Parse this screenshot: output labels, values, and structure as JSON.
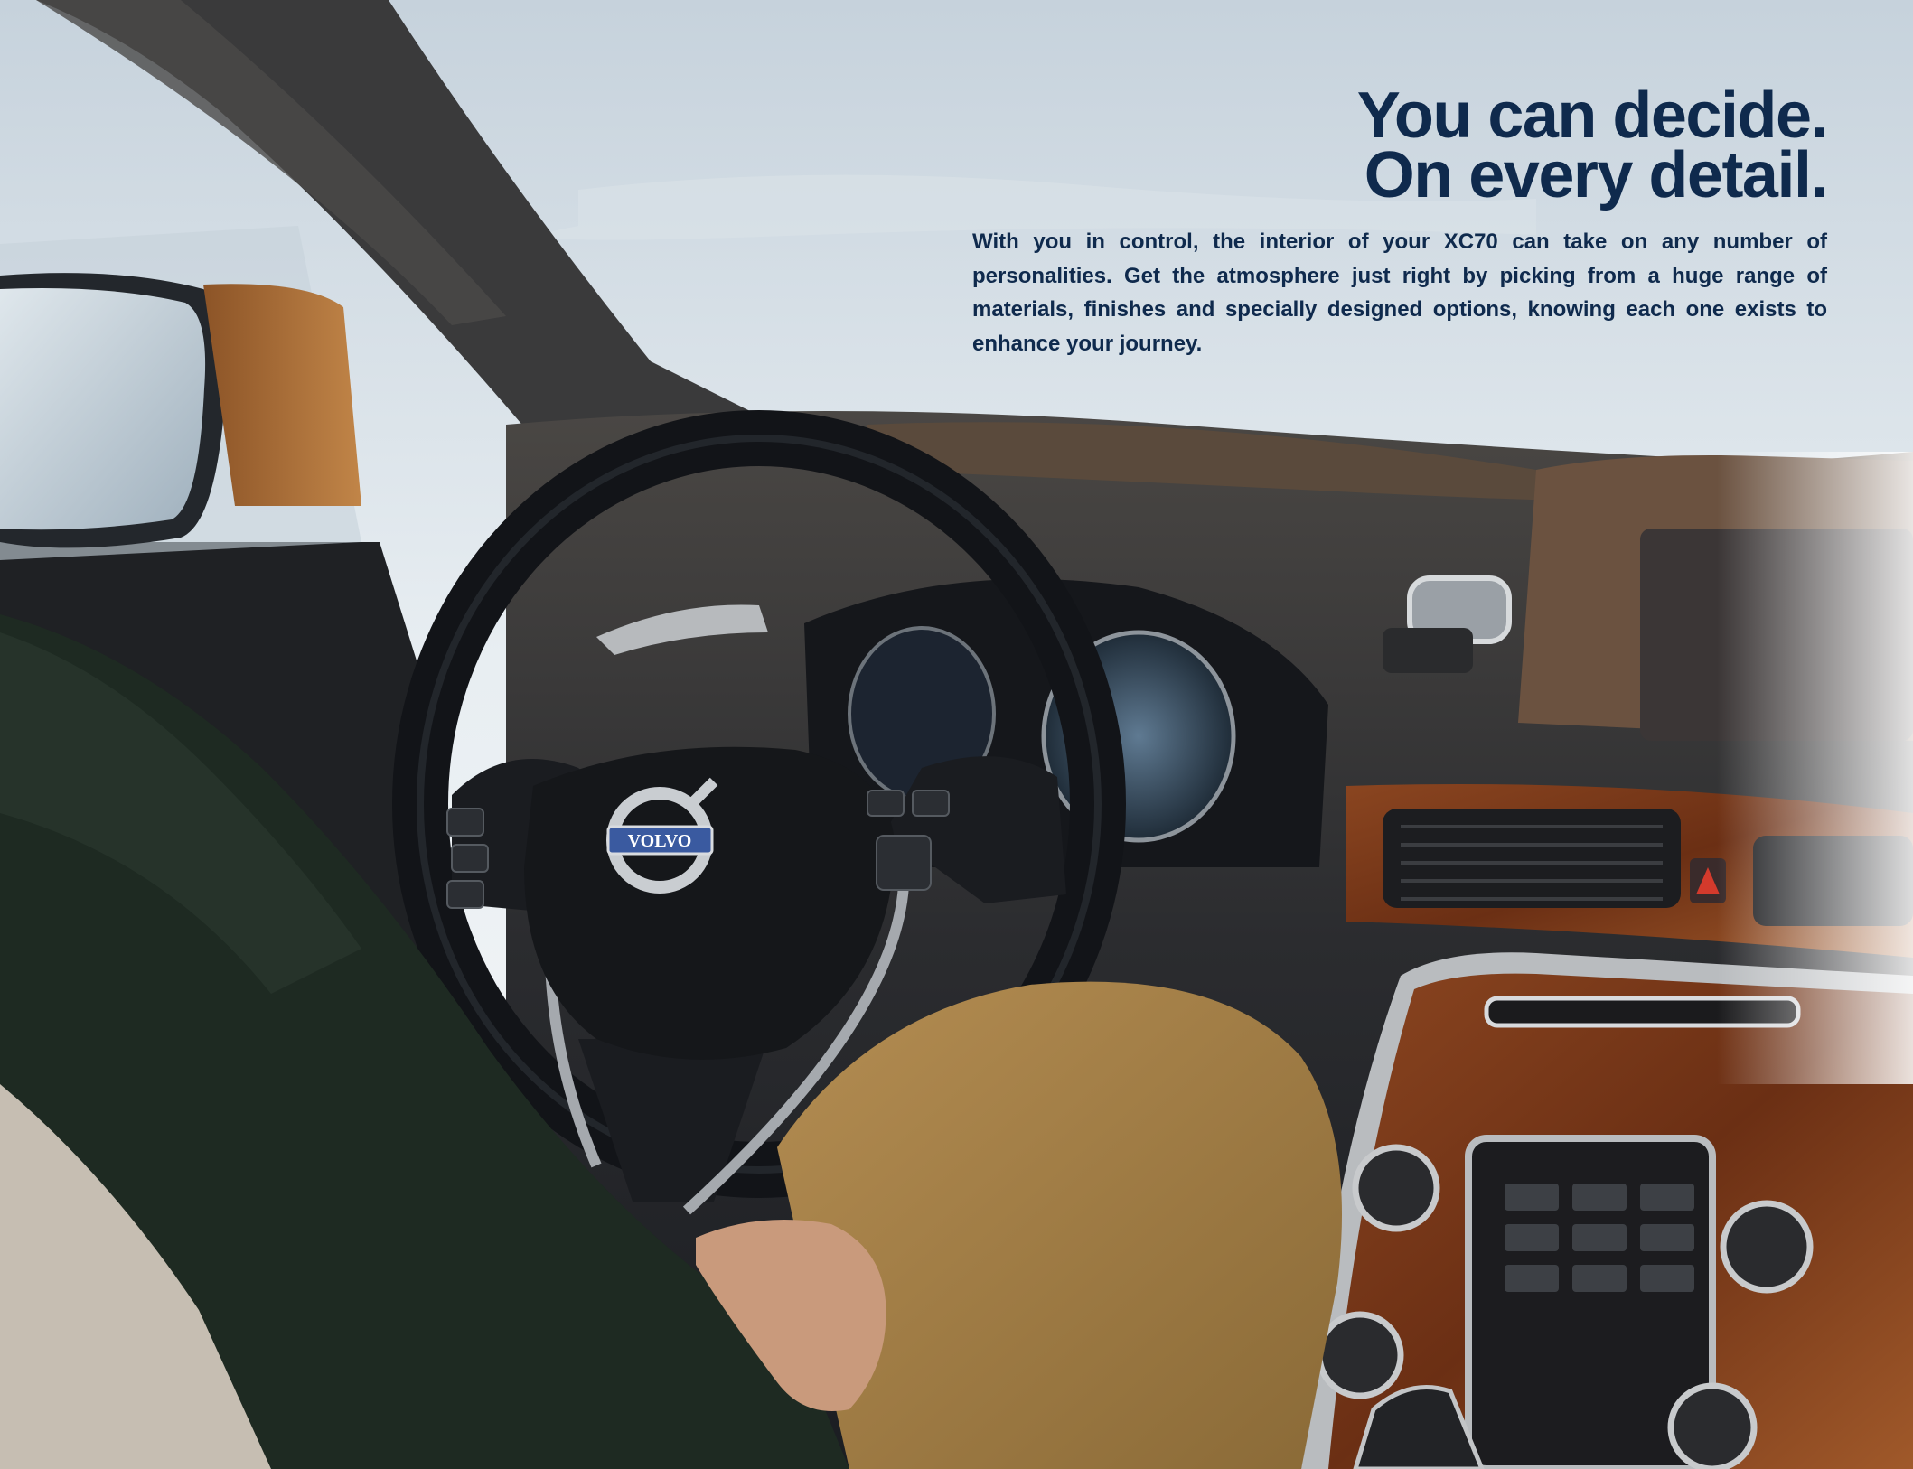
{
  "headline": {
    "line1": "You can decide.",
    "line2": "On every detail."
  },
  "body_text": "With you in control, the interior of your XC70 can take on any number of personalities. Get the atmosphere just right by picking from a huge range of materials, finishes and specially designed options, knowing each one exists to enhance your journey.",
  "badge": {
    "brand": "VOLVO"
  },
  "colors": {
    "headline": "#0f2a4d",
    "wood": "#7a3a1c",
    "leather": "#a9672f"
  }
}
